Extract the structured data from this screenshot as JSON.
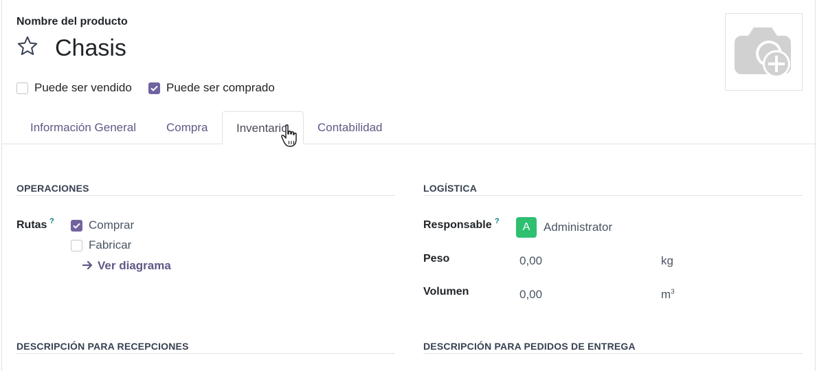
{
  "header": {
    "name_label": "Nombre del producto",
    "product_name": "Chasis"
  },
  "options": {
    "sold_label": "Puede ser vendido",
    "sold_checked": false,
    "purchased_label": "Puede ser comprado",
    "purchased_checked": true
  },
  "tabs": [
    {
      "label": "Información General",
      "active": false
    },
    {
      "label": "Compra",
      "active": false
    },
    {
      "label": "Inventario",
      "active": true
    },
    {
      "label": "Contabilidad",
      "active": false
    }
  ],
  "operations": {
    "title": "OPERACIONES",
    "routes_label": "Rutas",
    "help_mark": "?",
    "routes": [
      {
        "label": "Comprar",
        "checked": true
      },
      {
        "label": "Fabricar",
        "checked": false
      }
    ],
    "diagram_link": "Ver diagrama"
  },
  "logistics": {
    "title": "LOGÍSTICA",
    "responsible_label": "Responsable",
    "help_mark": "?",
    "avatar_letter": "A",
    "responsible_value": "Administrator",
    "weight_label": "Peso",
    "weight_value": "0,00",
    "weight_unit": "kg",
    "volume_label": "Volumen",
    "volume_value": "0,00",
    "volume_unit": "m",
    "volume_exp": "3"
  },
  "descriptions": {
    "receptions_title": "DESCRIPCIÓN PARA RECEPCIONES",
    "delivery_title": "DESCRIPCIÓN PARA PEDIDOS DE ENTREGA"
  },
  "colors": {
    "accent": "#71639e",
    "avatar_bg": "#2fbf71",
    "help": "#017e84"
  }
}
